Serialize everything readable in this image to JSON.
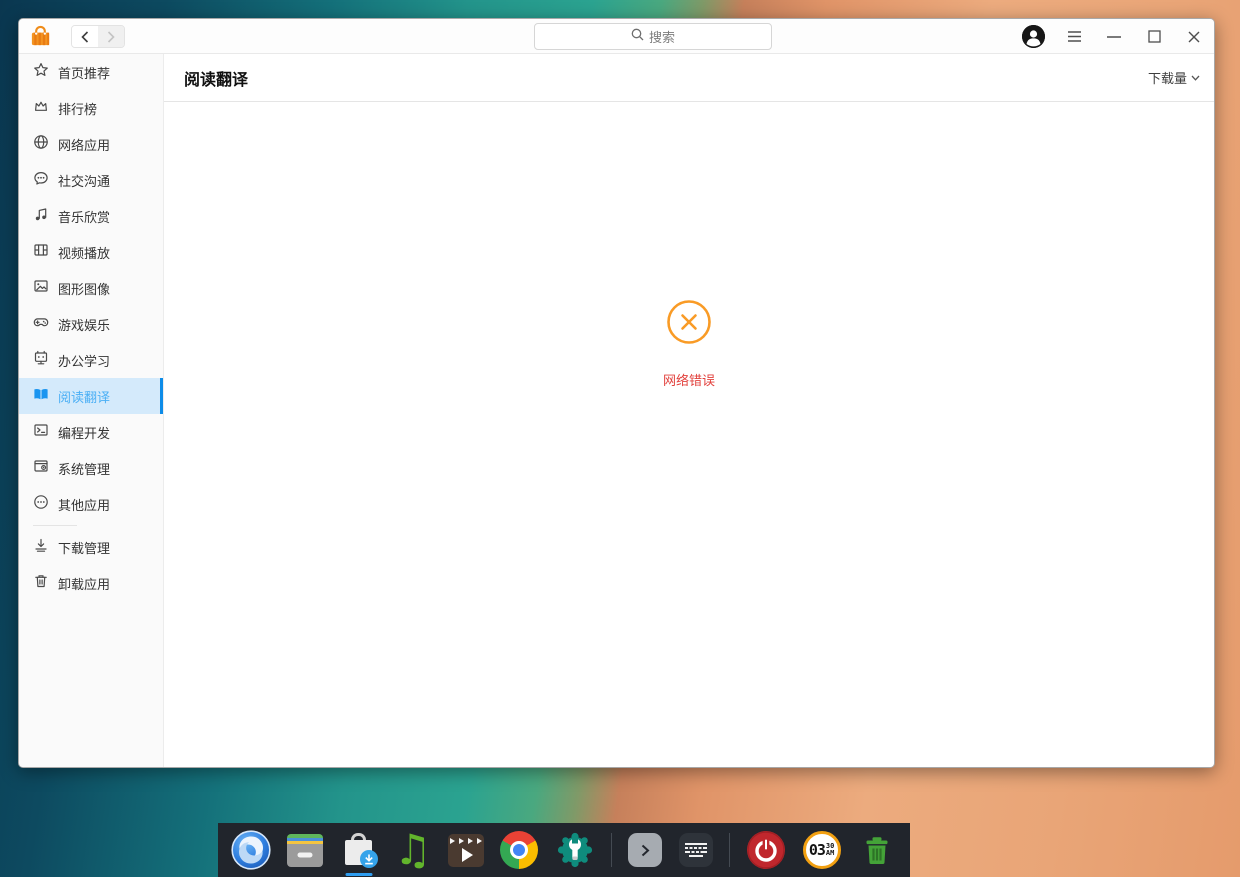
{
  "titlebar": {
    "search_placeholder": "搜索"
  },
  "sidebar": {
    "items": [
      {
        "label": "首页推荐",
        "icon": "star-icon"
      },
      {
        "label": "排行榜",
        "icon": "crown-icon"
      },
      {
        "label": "网络应用",
        "icon": "globe-icon"
      },
      {
        "label": "社交沟通",
        "icon": "chat-icon"
      },
      {
        "label": "音乐欣赏",
        "icon": "music-icon"
      },
      {
        "label": "视频播放",
        "icon": "video-icon"
      },
      {
        "label": "图形图像",
        "icon": "image-icon"
      },
      {
        "label": "游戏娱乐",
        "icon": "gamepad-icon"
      },
      {
        "label": "办公学习",
        "icon": "study-icon"
      },
      {
        "label": "阅读翻译",
        "icon": "book-icon",
        "active": true
      },
      {
        "label": "编程开发",
        "icon": "code-icon"
      },
      {
        "label": "系统管理",
        "icon": "system-icon"
      },
      {
        "label": "其他应用",
        "icon": "more-icon"
      }
    ],
    "footer_items": [
      {
        "label": "下载管理",
        "icon": "download-icon"
      },
      {
        "label": "卸载应用",
        "icon": "trash-icon"
      }
    ]
  },
  "content": {
    "title": "阅读翻译",
    "sort_label": "下载量",
    "error_message": "网络错误"
  },
  "dock": {
    "items": [
      "deepin-launcher-icon",
      "file-manager-icon",
      "app-store-icon",
      "music-player-icon",
      "movie-player-icon",
      "chrome-icon",
      "control-center-icon",
      "divider",
      "show-desktop-icon",
      "virtual-keyboard-icon",
      "divider",
      "shutdown-icon",
      "clock-icon",
      "trash-icon"
    ],
    "active_item": "app-store-icon",
    "clock_time": {
      "hour": "03",
      "minute": "30",
      "meridiem": "AM"
    }
  },
  "colors": {
    "accent_blue": "#1a95f0",
    "active_item_bg": "#d4eafb",
    "active_item_bar": "#0d8ce8",
    "error_orange": "#f99b26",
    "error_red": "#e2413d",
    "dock_bg": "#21252c"
  }
}
